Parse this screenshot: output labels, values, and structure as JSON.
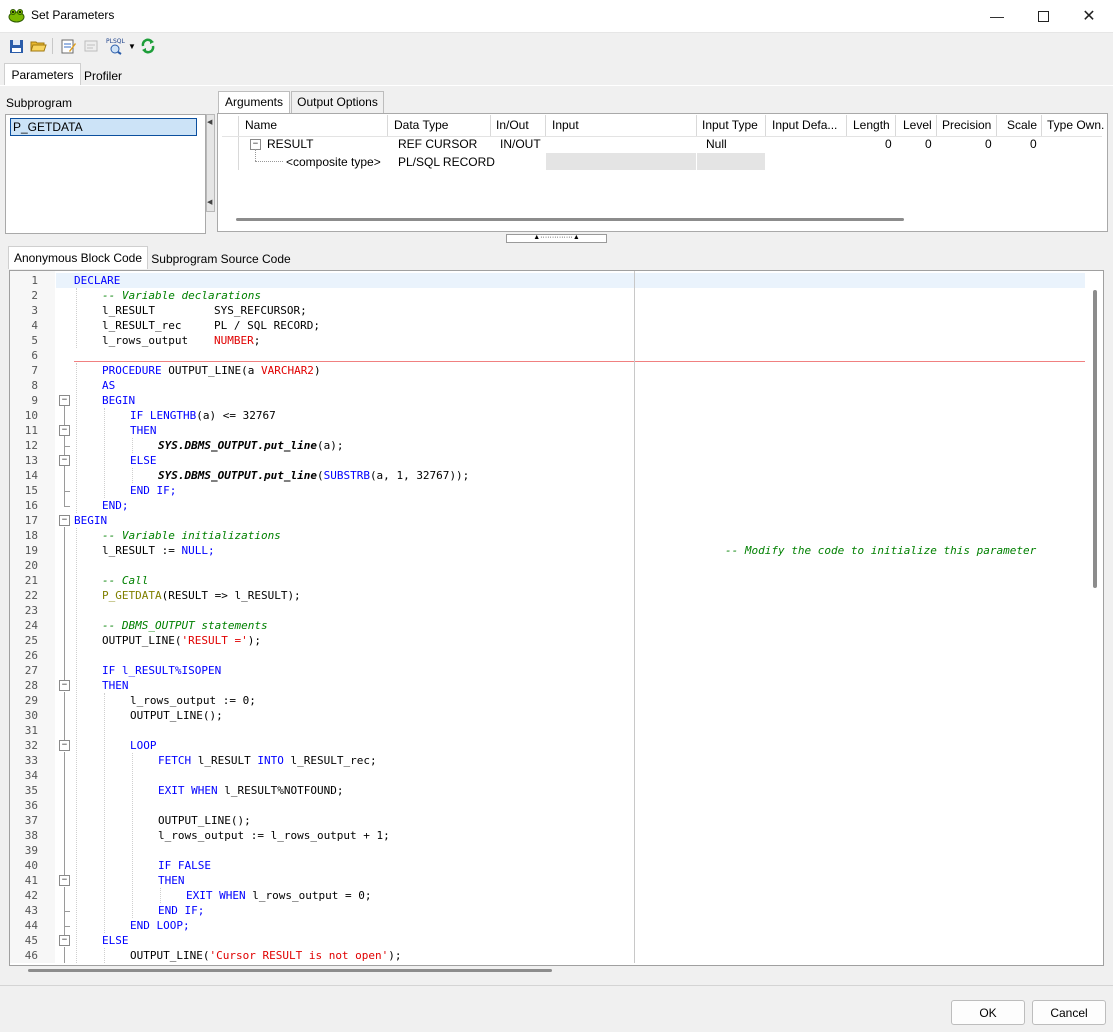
{
  "window": {
    "title": "Set Parameters"
  },
  "tabs": {
    "parameters": "Parameters",
    "profiler": "Profiler"
  },
  "subprogram": {
    "label": "Subprogram",
    "item": "P_GETDATA"
  },
  "arg_tabs": {
    "arguments": "Arguments",
    "output_options": "Output Options"
  },
  "grid": {
    "headers": [
      "Name",
      "Data Type",
      "In/Out",
      "Input",
      "Input Type",
      "Input Defa...",
      "Length",
      "Level",
      "Precision",
      "Scale",
      "Type Own."
    ],
    "rows": [
      {
        "name": "RESULT",
        "data_type": "REF CURSOR",
        "in_out": "IN/OUT",
        "input_type": "Null",
        "length": "0",
        "level": "0",
        "precision": "0",
        "scale": "0"
      },
      {
        "name": "<composite type>",
        "data_type": "PL/SQL RECORD"
      }
    ]
  },
  "code_tabs": {
    "anonymous": "Anonymous Block Code",
    "source": "Subprogram Source Code"
  },
  "code": {
    "line_numbers": [
      "1",
      "2",
      "3",
      "4",
      "5",
      "6",
      "7",
      "8",
      "9",
      "10",
      "11",
      "12",
      "13",
      "14",
      "15",
      "16",
      "17",
      "18",
      "19",
      "20",
      "21",
      "22",
      "23",
      "24",
      "25",
      "26",
      "27",
      "28",
      "29",
      "30",
      "31",
      "32",
      "33",
      "34",
      "35",
      "36",
      "37",
      "38",
      "39",
      "40",
      "41",
      "42",
      "43",
      "44",
      "45",
      "46"
    ],
    "l1": "DECLARE",
    "l2": "-- Variable declarations",
    "l3a": "l_RESULT",
    "l3b": "SYS_REFCURSOR;",
    "l4a": "l_RESULT_rec",
    "l4b": "PL / SQL RECORD;",
    "l5a": "l_rows_output",
    "l5b": "NUMBER",
    "l5c": ";",
    "l7a": "PROCEDURE",
    "l7b": " OUTPUT_LINE(a ",
    "l7c": "VARCHAR2",
    "l7d": ")",
    "l8": "AS",
    "l9": "BEGIN",
    "l10a": "IF LENGTHB",
    "l10b": "(a) <= ",
    "l10c": "32767",
    "l11": "THEN",
    "l12a": "SYS.DBMS_OUTPUT.put_line",
    "l12b": "(a);",
    "l13": "ELSE",
    "l14a": "SYS.DBMS_OUTPUT.put_line",
    "l14b": "(",
    "l14c": "SUBSTRB",
    "l14d": "(a, ",
    "l14e": "1",
    "l14f": ", ",
    "l14g": "32767",
    "l14h": "));",
    "l15": "END IF;",
    "l16": "END;",
    "l17": "BEGIN",
    "l18": "-- Variable initializations",
    "l19a": "l_RESULT := ",
    "l19b": "NULL;",
    "l19c": "-- Modify the code to initialize this parameter",
    "l21": "-- Call",
    "l22a": "P_GETDATA",
    "l22b": "(RESULT => l_RESULT);",
    "l24": "-- DBMS_OUTPUT statements",
    "l25a": "OUTPUT_LINE(",
    "l25b": "'RESULT ='",
    "l25c": ");",
    "l27": "IF l_RESULT%ISOPEN",
    "l28": "THEN",
    "l29a": "l_rows_output := ",
    "l29b": "0",
    "l29c": ";",
    "l30": "OUTPUT_LINE();",
    "l32": "LOOP",
    "l33a": "FETCH",
    "l33b": " l_RESULT ",
    "l33c": "INTO",
    "l33d": " l_RESULT_rec;",
    "l35a": "EXIT WHEN",
    "l35b": " l_RESULT%NOTFOUND;",
    "l37": "OUTPUT_LINE();",
    "l38a": "l_rows_output := l_rows_output + ",
    "l38b": "1",
    "l38c": ";",
    "l40": "IF FALSE",
    "l41": "THEN",
    "l42a": "EXIT WHEN",
    "l42b": " l_rows_output = ",
    "l42c": "0",
    "l42d": ";",
    "l43": "END IF;",
    "l44": "END LOOP;",
    "l45": "ELSE",
    "l46a": "OUTPUT_LINE(",
    "l46b": "'Cursor RESULT is not open'",
    "l46c": ");"
  },
  "buttons": {
    "ok": "OK",
    "cancel": "Cancel"
  },
  "icons": {
    "app": "frog-app-icon",
    "save": "save-icon",
    "open": "open-folder-icon",
    "edit": "edit-params-icon",
    "debug": "debug-icon",
    "plsql": "plsql-profiler-icon",
    "refresh": "refresh-icon"
  },
  "colors": {
    "keyword": "#0000ff",
    "comment": "#008000",
    "string": "#e00000",
    "selection": "#cce3f7"
  }
}
